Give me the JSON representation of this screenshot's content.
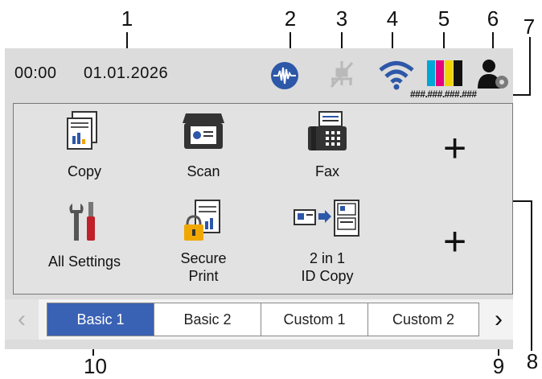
{
  "callouts": [
    "1",
    "2",
    "3",
    "4",
    "5",
    "6",
    "7",
    "8",
    "9",
    "10"
  ],
  "status": {
    "time": "00:00",
    "date": "01.01.2026",
    "ip": "###.###.###.###",
    "icons": [
      "wave-status-icon",
      "wired-lan-off-icon",
      "wifi-icon",
      "toner-icon",
      "user-settings-icon"
    ]
  },
  "tiles": {
    "copy": "Copy",
    "scan": "Scan",
    "fax": "Fax",
    "all_settings": "All Settings",
    "secure_print_line1": "Secure",
    "secure_print_line2": "Print",
    "id_copy_line1": "2 in 1",
    "id_copy_line2": "ID Copy",
    "plus": "+"
  },
  "tabs": [
    {
      "label": "Basic 1",
      "active": true
    },
    {
      "label": "Basic 2",
      "active": false
    },
    {
      "label": "Custom 1",
      "active": false
    },
    {
      "label": "Custom 2",
      "active": false
    }
  ],
  "nav": {
    "prev": "‹",
    "next": "›"
  },
  "colors": {
    "active_tab": "#3a62b4",
    "wave_icon": "#2d57a8",
    "toner_cyan": "#00a6d6",
    "toner_magenta": "#e5007e",
    "toner_yellow": "#f1d300"
  }
}
